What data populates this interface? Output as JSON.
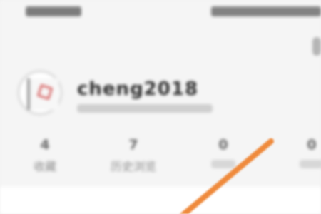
{
  "profile": {
    "username": "cheng2018"
  },
  "stats": [
    {
      "value": "4",
      "label": "收藏"
    },
    {
      "value": "7",
      "label": "历史浏览"
    },
    {
      "value": "0",
      "label": ""
    },
    {
      "value": "0",
      "label": ""
    }
  ],
  "annotation": {
    "arrow_color": "#ef8a3c"
  }
}
